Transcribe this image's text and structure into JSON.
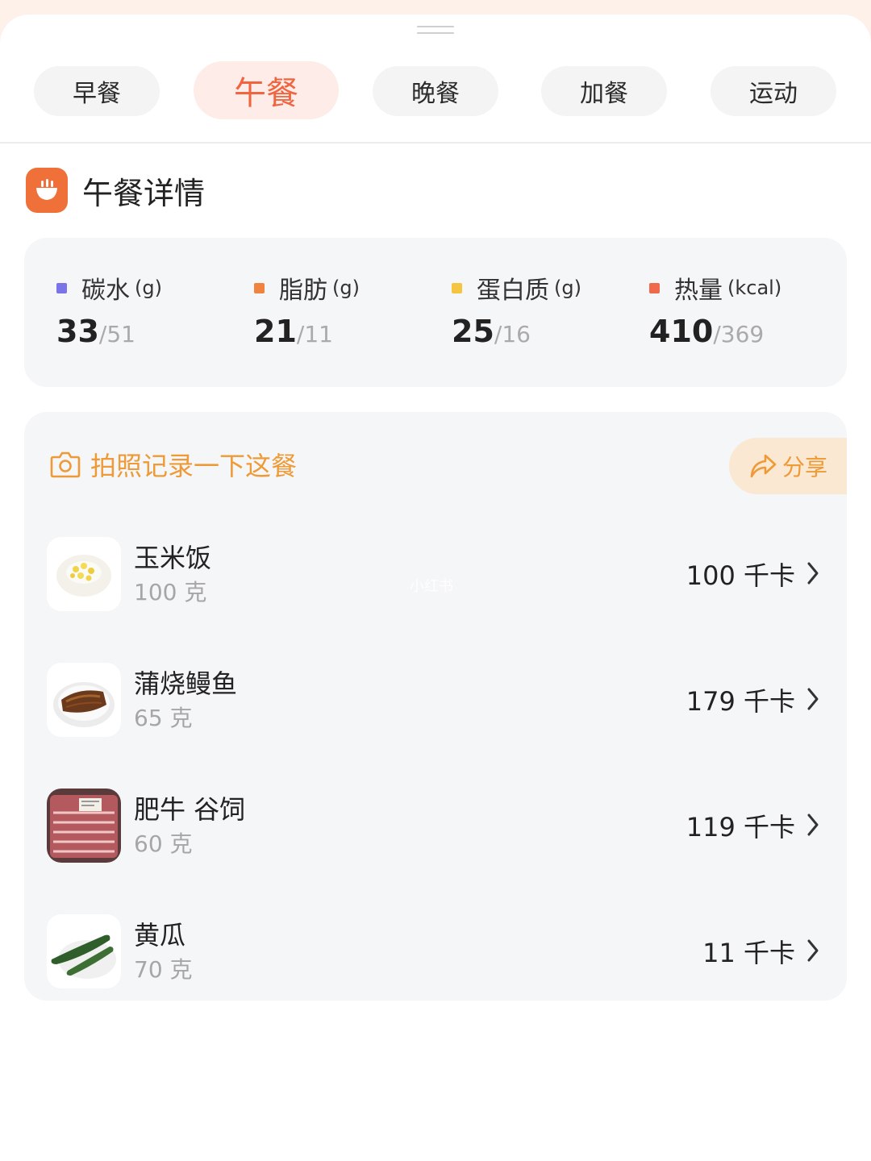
{
  "tabs": [
    {
      "label": "早餐",
      "active": false
    },
    {
      "label": "午餐",
      "active": true
    },
    {
      "label": "晚餐",
      "active": false
    },
    {
      "label": "加餐",
      "active": false
    },
    {
      "label": "运动",
      "active": false
    }
  ],
  "section": {
    "title": "午餐详情",
    "icon": "bowl-icon"
  },
  "macros": [
    {
      "name": "碳水",
      "unit": "(g)",
      "actual": "33",
      "target": "/51",
      "color": "#7b73e8"
    },
    {
      "name": "脂肪",
      "unit": "(g)",
      "actual": "21",
      "target": "/11",
      "color": "#f0843f"
    },
    {
      "name": "蛋白质",
      "unit": "(g)",
      "actual": "25",
      "target": "/16",
      "color": "#f5c542"
    },
    {
      "name": "热量",
      "unit": "(kcal)",
      "actual": "410",
      "target": "/369",
      "color": "#ef6a4a"
    }
  ],
  "photo_prompt": {
    "label": "拍照记录一下这餐",
    "icon": "camera-icon"
  },
  "share": {
    "label": "分享",
    "icon": "share-arrow-icon"
  },
  "foods": [
    {
      "name": "玉米饭",
      "quantity": "100 克",
      "kcal": "100 千卡",
      "thumb": "corn-rice"
    },
    {
      "name": "蒲烧鳗鱼",
      "quantity": "65 克",
      "kcal": "179 千卡",
      "thumb": "grilled-eel"
    },
    {
      "name": "肥牛 谷饲",
      "quantity": "60 克",
      "kcal": "119 千卡",
      "thumb": "beef-slices"
    },
    {
      "name": "黄瓜",
      "quantity": "70 克",
      "kcal": "11 千卡",
      "thumb": "cucumber"
    }
  ],
  "watermark": "小红书",
  "colors": {
    "accent": "#f0643f",
    "orange": "#ee9a36",
    "card": "#f5f6f8"
  }
}
